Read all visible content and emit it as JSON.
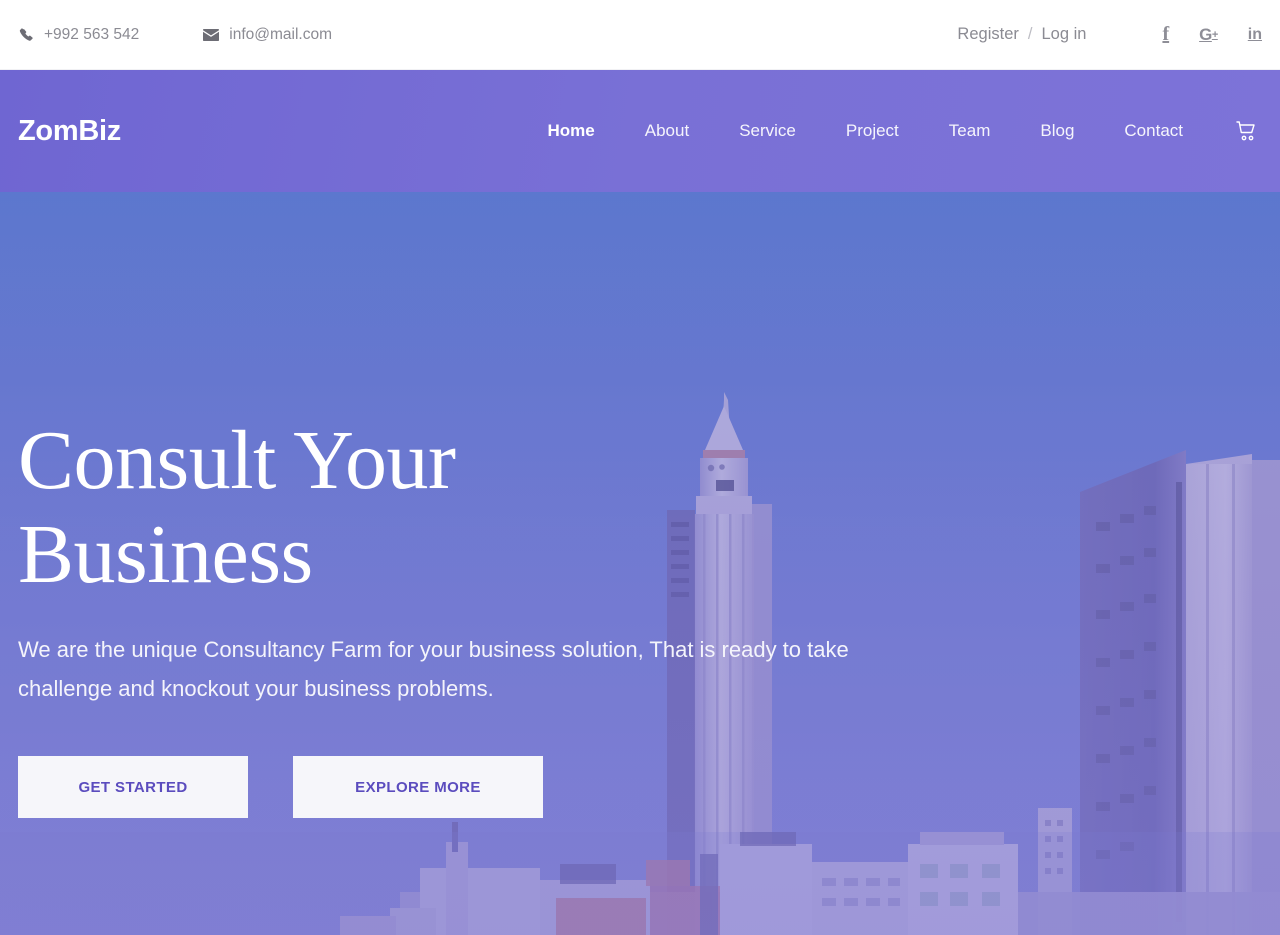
{
  "topbar": {
    "phone": "+992 563 542",
    "email": "info@mail.com",
    "phone_icon": "phone-icon",
    "email_icon": "envelope-icon",
    "register_label": "Register",
    "separator": "/",
    "login_label": "Log in",
    "socials": [
      {
        "name": "facebook-icon",
        "glyph": "f"
      },
      {
        "name": "google-plus-icon",
        "glyph": "G"
      },
      {
        "name": "linkedin-icon",
        "glyph": "in"
      }
    ]
  },
  "navbar": {
    "logo": "ZomBiz",
    "accent_color": "#7970d6",
    "cart_icon": "shopping-cart-icon",
    "links": [
      {
        "label": "Home",
        "active": true
      },
      {
        "label": "About",
        "active": false
      },
      {
        "label": "Service",
        "active": false
      },
      {
        "label": "Project",
        "active": false
      },
      {
        "label": "Team",
        "active": false
      },
      {
        "label": "Blog",
        "active": false
      },
      {
        "label": "Contact",
        "active": false
      }
    ]
  },
  "hero": {
    "title_line1": "Consult Your",
    "title_line2": "Business",
    "subtitle": "We are the unique Consultancy Farm for your business solution, That is ready to take challenge and knockout your business problems.",
    "primary_button": "GET STARTED",
    "secondary_button": "EXPLORE MORE",
    "button_text_color": "#5b4cbe",
    "button_bg_color": "#f6f6fa",
    "background": "city skyline photograph with purple-blue overlay"
  }
}
